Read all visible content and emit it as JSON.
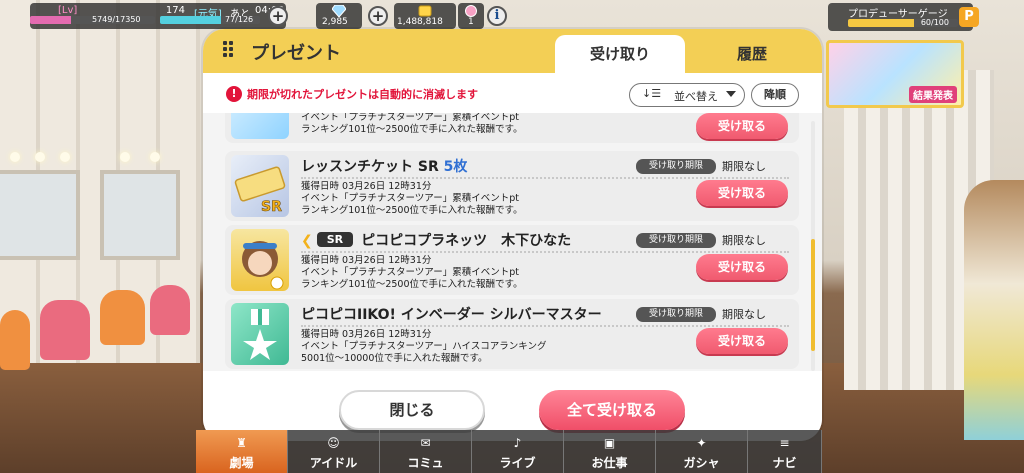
{
  "status": {
    "lv_tag": "[Lv]",
    "lv_value": "174",
    "exp": "5749/17350",
    "exp_ratio": 0.331,
    "stamina_tag": "[元気]",
    "stamina_until_label": "あと",
    "stamina_until_value": "04:08",
    "stamina": "77/126",
    "stamina_ratio": 0.611,
    "jewels": "2,985",
    "money": "1,488,818",
    "tickets": "1"
  },
  "produce_gauge": {
    "label": "プロデューサーゲージ",
    "value": "60/100",
    "ratio": 0.6,
    "icon_letter": "P"
  },
  "banner": {
    "result_label": "結果発表"
  },
  "dialog": {
    "title": "プレゼント",
    "tabs": [
      {
        "label": "受け取り",
        "active": true
      },
      {
        "label": "履歴",
        "active": false
      }
    ],
    "warning": "期限が切れたプレゼントは自動的に消滅します",
    "sort_label": "並べ替え",
    "order_label": "降順",
    "items": [
      {
        "name": "",
        "desc1": "イベント「プラチナスターツアー」累積イベントpt",
        "desc2": "ランキング101位～2500位で手に入れた報酬です。",
        "button": "受け取る"
      },
      {
        "name": "レッスンチケット SR",
        "count": "5枚",
        "limit_badge": "受け取り期限",
        "limit": "期限なし",
        "date": "獲得日時 03月26日 12時31分",
        "desc1": "イベント「プラチナスターツアー」累積イベントpt",
        "desc2": "ランキング101位～2500位で手に入れた報酬です。",
        "button": "受け取る"
      },
      {
        "rarity": "SR",
        "name": "ピコピコプラネッツ　木下ひなた",
        "limit_badge": "受け取り期限",
        "limit": "期限なし",
        "date": "獲得日時 03月26日 12時31分",
        "desc1": "イベント「プラチナスターツアー」累積イベントpt",
        "desc2": "ランキング101位～2500位で手に入れた報酬です。",
        "button": "受け取る"
      },
      {
        "name": "ピコピコIIKO! インベーダー シルバーマスター",
        "limit_badge": "受け取り期限",
        "limit": "期限なし",
        "date": "獲得日時 03月26日 12時31分",
        "desc1": "イベント「プラチナスターツアー」ハイスコアランキング",
        "desc2": "5001位～10000位で手に入れた報酬です。",
        "button": "受け取る"
      }
    ],
    "close_label": "閉じる",
    "receive_all_label": "全て受け取る"
  },
  "nav": [
    {
      "label": "劇場",
      "icon": "theater-icon",
      "active": true
    },
    {
      "label": "アイドル",
      "icon": "idol-icon",
      "active": false
    },
    {
      "label": "コミュ",
      "icon": "commu-icon",
      "active": false
    },
    {
      "label": "ライブ",
      "icon": "live-icon",
      "active": false
    },
    {
      "label": "お仕事",
      "icon": "work-icon",
      "active": false
    },
    {
      "label": "ガシャ",
      "icon": "gacha-icon",
      "active": false
    },
    {
      "label": "ナビ",
      "icon": "navi-icon",
      "active": false
    }
  ],
  "colors": {
    "header_gold": "#f3cf55",
    "receive_pink": "#f05a6f",
    "warning_red": "#e2143a",
    "nav_active": "#e07b2e"
  }
}
